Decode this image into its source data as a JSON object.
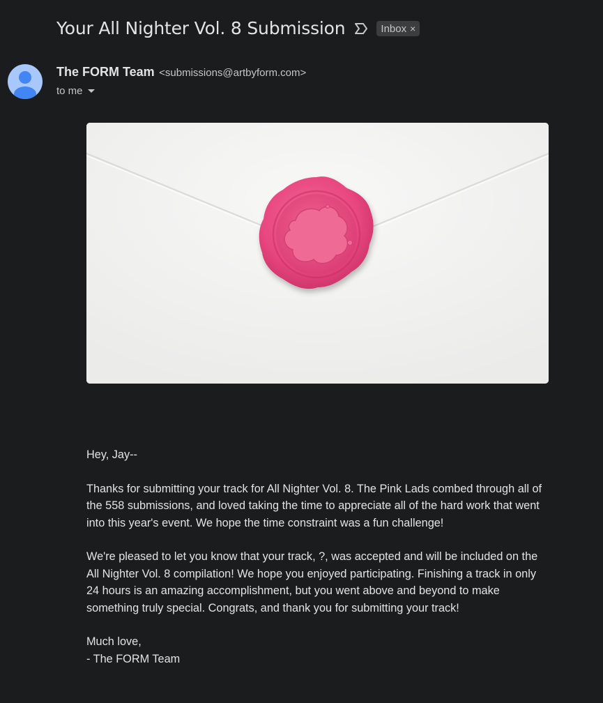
{
  "subject": "Your All Nighter Vol. 8 Submission",
  "label_chip": {
    "text": "Inbox",
    "close": "×",
    "icon": "importance-marker-icon"
  },
  "sender": {
    "name": "The FORM Team",
    "email": "<submissions@artbyform.com>",
    "to_line": "to me",
    "avatar_icon": "default-avatar-icon"
  },
  "image": {
    "description_icon": "envelope-wax-seal-image",
    "seal_color": "#e8477f"
  },
  "message": {
    "greeting": "Hey, Jay--",
    "paragraph1": "Thanks for submitting your track for All Nighter Vol. 8. The Pink Lads combed through all of the 558 submissions, and loved taking the time to appreciate all of the hard work that went into this year's event. We hope the time constraint was a fun challenge!",
    "paragraph2": "We're pleased to let you know that your track, ?, was accepted and will be included on the All Nighter Vol. 8 compilation! We hope you enjoyed participating. Finishing a track in only 24 hours is an amazing accomplishment, but you went above and beyond to make something truly special. Congrats, and thank you for submitting your track!",
    "signoff": "Much love,",
    "signature": "- The FORM Team"
  },
  "colors": {
    "background": "#1b1c1e",
    "text": "#e3e3e3",
    "muted": "#c4c7c5",
    "avatar": "#a8c7fa",
    "avatar_figure": "#4285f4"
  }
}
